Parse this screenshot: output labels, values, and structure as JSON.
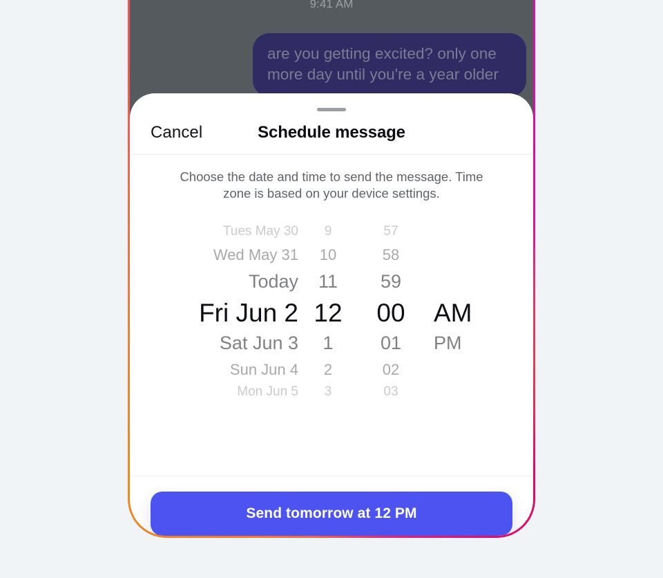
{
  "theme": {
    "page_background": "#f1f4f7",
    "frame_gradient_start": "#f2564f",
    "frame_gradient_mid": "#ed8b1f",
    "frame_gradient_end": "#dd0a6e",
    "chat_dim_background": "#555a5e",
    "bubble_color": "#302b63",
    "accent_button": "#4c53f0",
    "sheet_background": "#ffffff"
  },
  "chat": {
    "timestamp": "9:41 AM",
    "bubble_text": "are you getting excited? only one more day until you're a year older"
  },
  "sheet": {
    "grabber": "drag-handle",
    "cancel_label": "Cancel",
    "title": "Schedule message",
    "description": "Choose the date and time to send the message. Time zone is based on your device settings."
  },
  "picker": {
    "columns": [
      "date",
      "hour",
      "minute",
      "meridiem"
    ],
    "selected": {
      "date": "Fri Jun 2",
      "hour": "12",
      "minute": "00",
      "meridiem": "AM"
    },
    "rows": [
      {
        "offset": -3,
        "date": "Tues May 30",
        "hour": "9",
        "minute": "57",
        "meridiem": ""
      },
      {
        "offset": -2,
        "date": "Wed May 31",
        "hour": "10",
        "minute": "58",
        "meridiem": ""
      },
      {
        "offset": -1,
        "date": "Today",
        "hour": "11",
        "minute": "59",
        "meridiem": ""
      },
      {
        "offset": 0,
        "date": "Fri Jun 2",
        "hour": "12",
        "minute": "00",
        "meridiem": "AM"
      },
      {
        "offset": 1,
        "date": "Sat Jun 3",
        "hour": "1",
        "minute": "01",
        "meridiem": "PM"
      },
      {
        "offset": 2,
        "date": "Sun Jun 4",
        "hour": "2",
        "minute": "02",
        "meridiem": ""
      },
      {
        "offset": 3,
        "date": "Mon Jun 5",
        "hour": "3",
        "minute": "03",
        "meridiem": ""
      }
    ]
  },
  "footer": {
    "send_label": "Send tomorrow at 12 PM"
  }
}
